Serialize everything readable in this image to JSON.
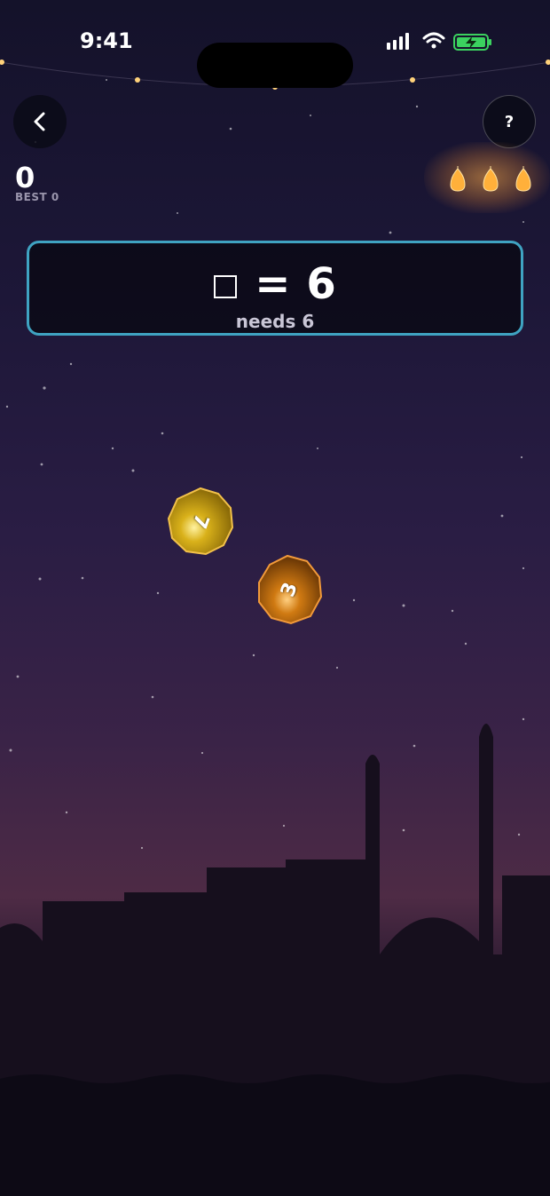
{
  "status_bar": {
    "time": "9:41"
  },
  "nav": {
    "back_icon": "chevron-left-icon",
    "help_label": "?"
  },
  "score": {
    "value": "0",
    "best_label": "BEST 0"
  },
  "lives": {
    "count": 3,
    "icon": "flame-icon",
    "color": "#ffb03a"
  },
  "equation": {
    "blank": "□",
    "symbol": "=",
    "target": "6",
    "needs_label": "needs 6",
    "border_color": "#3fa3c2"
  },
  "coins": [
    {
      "label": "7",
      "color": "#d4a017"
    },
    {
      "label": "3",
      "color": "#d97d12"
    }
  ]
}
